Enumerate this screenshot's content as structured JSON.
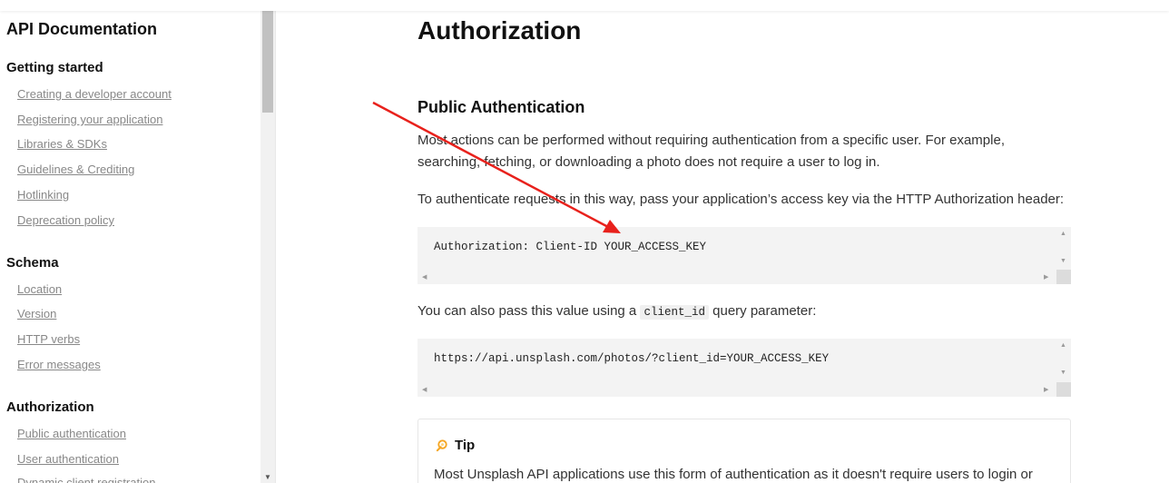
{
  "sidebar": {
    "title": "API Documentation",
    "sections": [
      {
        "title": "Getting started",
        "links": [
          "Creating a developer account",
          "Registering your application",
          "Libraries & SDKs",
          "Guidelines & Crediting",
          "Hotlinking",
          "Deprecation policy"
        ]
      },
      {
        "title": "Schema",
        "links": [
          "Location",
          "Version",
          "HTTP verbs",
          "Error messages"
        ]
      },
      {
        "title": "Authorization",
        "links": [
          "Public authentication",
          "User authentication",
          "Dynamic client registration"
        ]
      }
    ]
  },
  "main": {
    "title": "Authorization",
    "subtitle": "Public Authentication",
    "para1_line1": "Most actions can be performed without requiring authentication from a specific user. For example,",
    "para1_line2": "searching, fetching, or downloading a photo does not require a user to log in.",
    "para2": "To authenticate requests in this way, pass your application’s access key via the HTTP Authorization header:",
    "code1": "Authorization: Client-ID YOUR_ACCESS_KEY",
    "para3_before": "You can also pass this value using a ",
    "para3_code": "client_id",
    "para3_after": " query parameter:",
    "code2": "https://api.unsplash.com/photos/?client_id=YOUR_ACCESS_KEY",
    "tip_title": "Tip",
    "tip_text": "Most Unsplash API applications use this form of authentication as it doesn't require users to login or"
  },
  "colors": {
    "arrow": "#e8211c",
    "link": "#888888",
    "code_bg": "#f3f3f3"
  },
  "icons": {
    "tip": "lightbulb-icon",
    "annotation": "red-arrow-icon"
  }
}
